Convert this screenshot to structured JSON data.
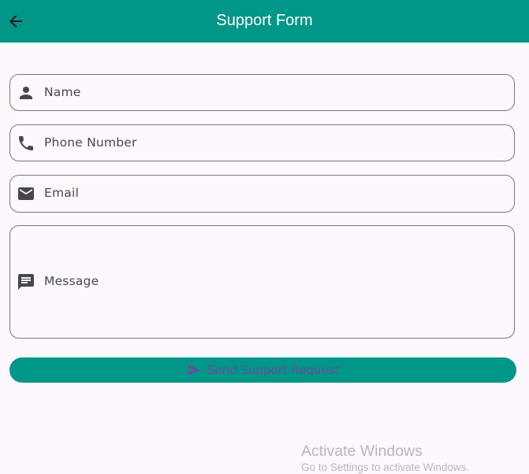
{
  "appbar": {
    "title": "Support Form",
    "back_icon": "arrow-back-icon",
    "background": "#009688"
  },
  "form": {
    "name": {
      "label": "Name",
      "icon": "person-icon"
    },
    "phone": {
      "label": "Phone Number",
      "icon": "phone-icon"
    },
    "email": {
      "label": "Email",
      "icon": "mail-icon"
    },
    "message": {
      "label": "Message",
      "icon": "message-icon"
    }
  },
  "submit": {
    "label": "Send Support Request",
    "icon": "send-icon",
    "background": "#009688"
  },
  "watermark": {
    "title": "Activate Windows",
    "subtitle": "Go to Settings to activate Windows."
  }
}
